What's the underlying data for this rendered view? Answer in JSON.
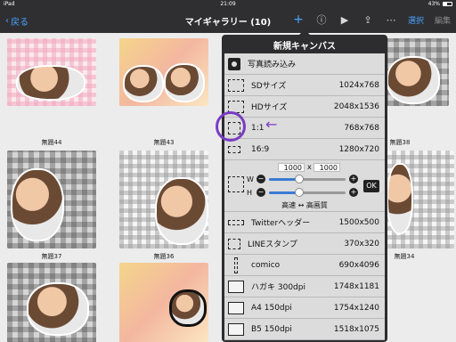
{
  "status": {
    "left": "iPad",
    "time": "21:09",
    "battery": "43%"
  },
  "nav": {
    "back_label": "戻る",
    "title": "マイギャラリー (10)",
    "icons": [
      "plus-icon",
      "info-icon",
      "play-icon",
      "share-icon",
      "more-icon"
    ],
    "select_label": "選択",
    "edit_label": "編集"
  },
  "gallery": {
    "captions": [
      "無題44",
      "無題43",
      "無題38",
      "無題37",
      "無題36",
      "無題34"
    ]
  },
  "popover": {
    "title": "新規キャンバス",
    "import_label": "写真読み込み",
    "presets": [
      {
        "name": "SDサイズ",
        "size": "1024x768"
      },
      {
        "name": "HDサイズ",
        "size": "2048x1536"
      },
      {
        "name": "1:1",
        "size": "768x768"
      },
      {
        "name": "16:9",
        "size": "1280x720"
      }
    ],
    "custom": {
      "width": "1000",
      "x": "x",
      "height": "1000",
      "w_label": "W",
      "h_label": "H",
      "w_level": 0.4,
      "h_level": 0.4,
      "ok_label": "OK",
      "speed_label": "高速 ↔ 高画質"
    },
    "presets2": [
      {
        "name": "Twitterヘッダー",
        "size": "1500x500"
      },
      {
        "name": "LINEスタンプ",
        "size": "370x320"
      },
      {
        "name": "comico",
        "size": "690x4096"
      },
      {
        "name": "ハガキ 300dpi",
        "size": "1748x1181"
      },
      {
        "name": "A4 150dpi",
        "size": "1754x1240"
      },
      {
        "name": "B5 150dpi",
        "size": "1518x1075"
      }
    ]
  },
  "annotation": {
    "color": "#7a3cc4",
    "arrow": "←"
  }
}
